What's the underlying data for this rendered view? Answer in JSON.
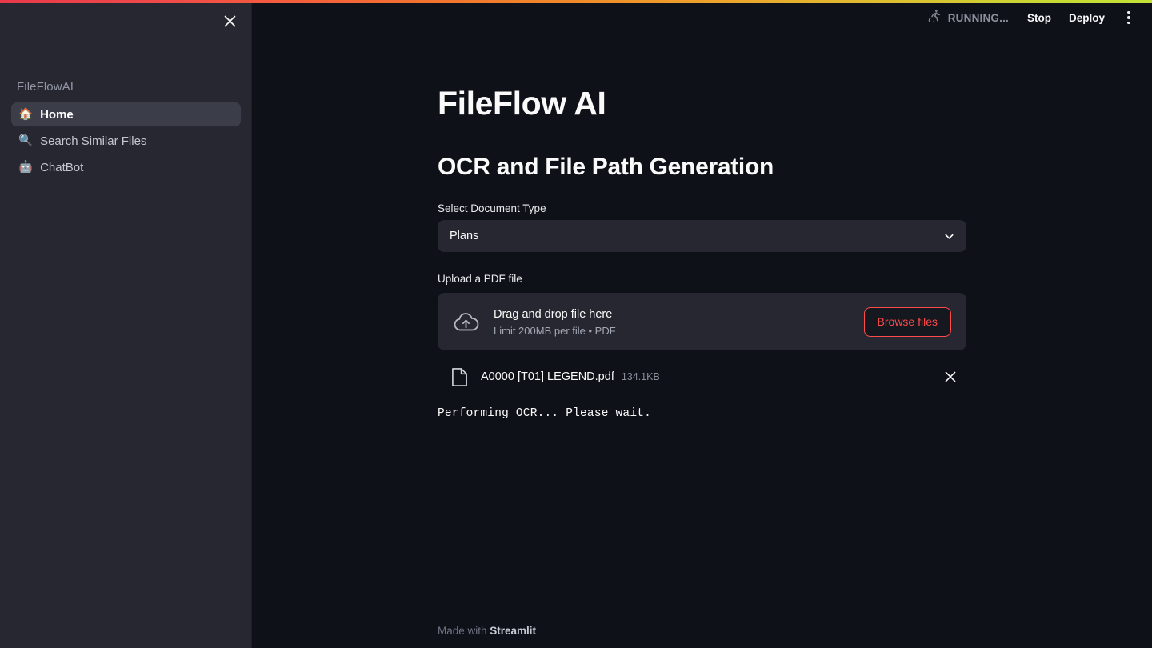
{
  "app": {
    "top_gradient_colors": [
      "#e8394a",
      "#ef8b2a",
      "#c3e336"
    ],
    "background_color": "#0e1117",
    "sidebar_background_color": "#262730",
    "accent_color": "#ff4b4b"
  },
  "toolbar": {
    "status_icon": "running-man-icon",
    "status_label": "RUNNING...",
    "stop_label": "Stop",
    "deploy_label": "Deploy",
    "overflow_icon": "three-dots-vertical-icon"
  },
  "sidebar": {
    "close_icon": "close-icon",
    "brand": "FileFlowAI",
    "items": [
      {
        "emoji": "🏠",
        "icon_name": "house-icon",
        "label": "Home",
        "active": true
      },
      {
        "emoji": "🔍",
        "icon_name": "magnifying-glass-icon",
        "label": "Search Similar Files",
        "active": false
      },
      {
        "emoji": "🤖",
        "icon_name": "robot-icon",
        "label": "ChatBot",
        "active": false
      }
    ]
  },
  "main": {
    "title": "FileFlow AI",
    "section_heading": "OCR and File Path Generation",
    "doc_type": {
      "label": "Select Document Type",
      "value": "Plans",
      "chevron_icon": "chevron-down-icon"
    },
    "uploader": {
      "label": "Upload a PDF file",
      "cloud_icon": "cloud-upload-icon",
      "drag_text": "Drag and drop file here",
      "limit_text": "Limit 200MB per file • PDF",
      "browse_label": "Browse files"
    },
    "uploaded_file": {
      "doc_icon": "document-icon",
      "name": "A0000 [T01] LEGEND.pdf",
      "size": "134.1KB",
      "remove_icon": "close-icon"
    },
    "status_message": "Performing OCR... Please wait."
  },
  "footer": {
    "prefix": "Made with ",
    "brand": "Streamlit"
  }
}
